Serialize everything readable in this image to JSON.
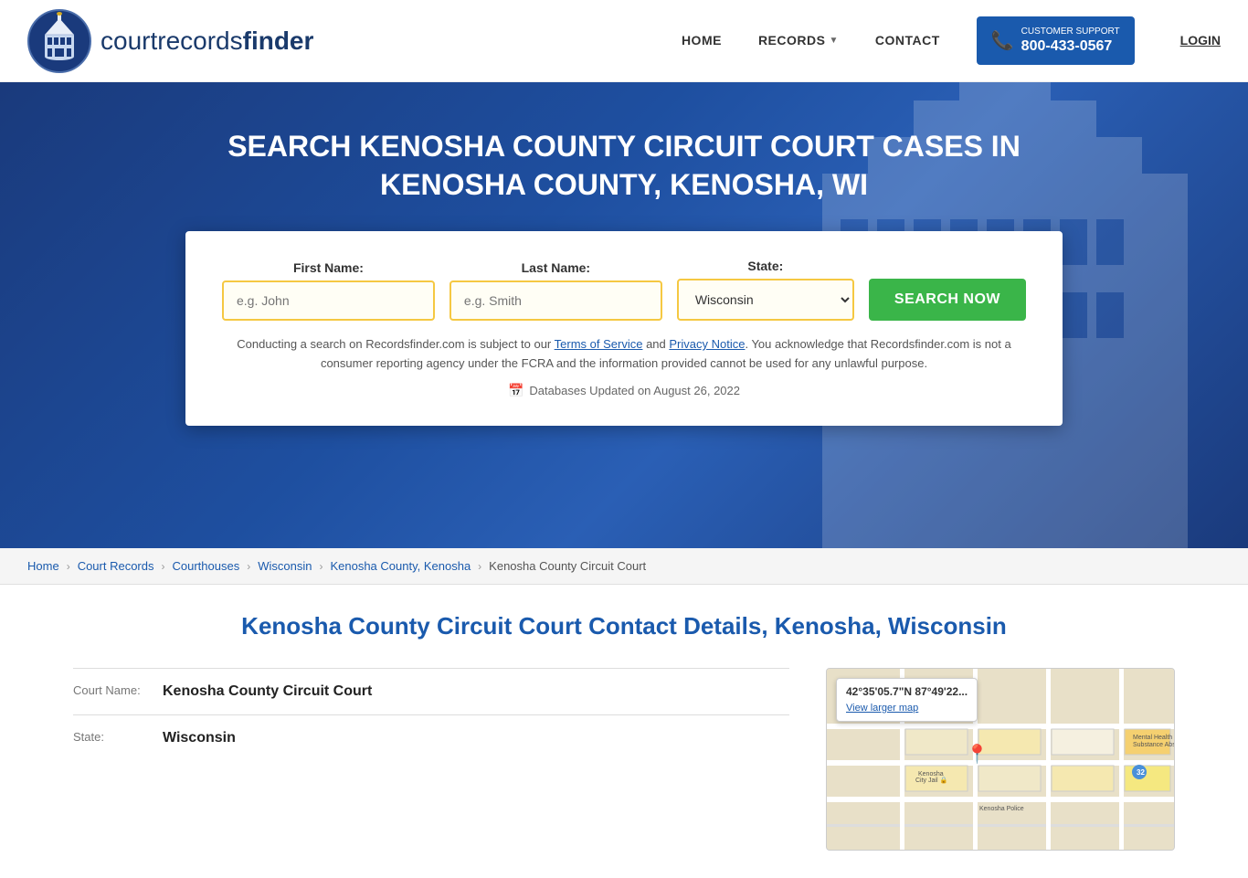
{
  "header": {
    "logo_text_light": "courtrecords",
    "logo_text_bold": "finder",
    "nav": {
      "home_label": "HOME",
      "records_label": "RECORDS",
      "contact_label": "CONTACT",
      "login_label": "LOGIN"
    },
    "phone": {
      "support_label": "CUSTOMER SUPPORT",
      "number": "800-433-0567"
    }
  },
  "hero": {
    "title": "SEARCH KENOSHA COUNTY CIRCUIT COURT CASES IN KENOSHA COUNTY, KENOSHA, WI",
    "fields": {
      "first_name_label": "First Name:",
      "first_name_placeholder": "e.g. John",
      "last_name_label": "Last Name:",
      "last_name_placeholder": "e.g. Smith",
      "state_label": "State:",
      "state_value": "Wisconsin"
    },
    "search_button": "SEARCH NOW",
    "disclaimer": "Conducting a search on Recordsfinder.com is subject to our Terms of Service and Privacy Notice. You acknowledge that Recordsfinder.com is not a consumer reporting agency under the FCRA and the information provided cannot be used for any unlawful purpose.",
    "db_updated": "Databases Updated on August 26, 2022"
  },
  "breadcrumb": {
    "items": [
      {
        "label": "Home",
        "href": "#"
      },
      {
        "label": "Court Records",
        "href": "#"
      },
      {
        "label": "Courthouses",
        "href": "#"
      },
      {
        "label": "Wisconsin",
        "href": "#"
      },
      {
        "label": "Kenosha County, Kenosha",
        "href": "#"
      },
      {
        "label": "Kenosha County Circuit Court",
        "href": "#"
      }
    ]
  },
  "main": {
    "section_title": "Kenosha County Circuit Court Contact Details, Kenosha, Wisconsin",
    "court_details": {
      "court_name_label": "Court Name:",
      "court_name_value": "Kenosha County Circuit Court",
      "state_label": "State:",
      "state_value": "Wisconsin"
    },
    "map": {
      "coordinates": "42°35'05.7\"N 87°49'22...",
      "view_larger": "View larger map",
      "label1": "Mental Health &\nSubstance Abs",
      "label2": "Kenosha City Jail",
      "label3": "Kenosha Police"
    }
  }
}
